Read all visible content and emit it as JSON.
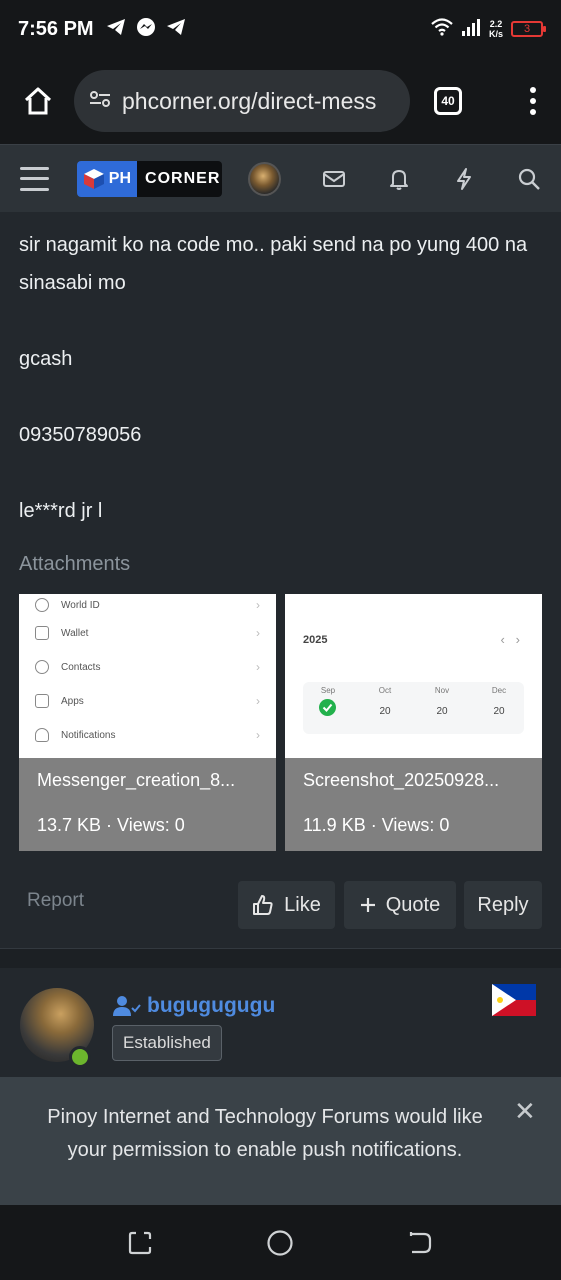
{
  "status": {
    "time": "7:56 PM",
    "speed_value": "2.2",
    "speed_unit": "K/s",
    "battery": "3"
  },
  "browser": {
    "url": "phcorner.org/direct-mess",
    "tab_count": "40"
  },
  "site": {
    "logo_ph": "PH",
    "logo_corner": "CORNER"
  },
  "message": {
    "lines": [
      "sir nagamit ko na code mo.. paki send na po yung 400 na sinasabi mo",
      "gcash",
      "09350789056",
      "le***rd jr l"
    ]
  },
  "attachments": {
    "label": "Attachments",
    "items": [
      {
        "filename": "Messenger_creation_8...",
        "meta": "13.7 KB · Views: 0",
        "preview_rows": [
          "World ID",
          "Wallet",
          "Contacts",
          "Apps",
          "Notifications"
        ]
      },
      {
        "filename": "Screenshot_20250928...",
        "meta": "11.9 KB · Views: 0",
        "preview_year": "2025",
        "preview_months": [
          "Sep",
          "Oct",
          "Nov",
          "Dec"
        ],
        "preview_values": [
          "20",
          "20",
          "20"
        ]
      }
    ]
  },
  "actions": {
    "report": "Report",
    "like": "Like",
    "quote": "Quote",
    "reply": "Reply"
  },
  "next_post": {
    "username": "bugugugugu",
    "badge": "Established"
  },
  "notification": {
    "text": "Pinoy Internet and Technology Forums would like your permission to enable push notifications.",
    "close_icon": "close-icon"
  },
  "colors": {
    "link_blue": "#4f8be0",
    "online_green": "#6cb52d",
    "logo_blue": "#2f6bd8"
  }
}
